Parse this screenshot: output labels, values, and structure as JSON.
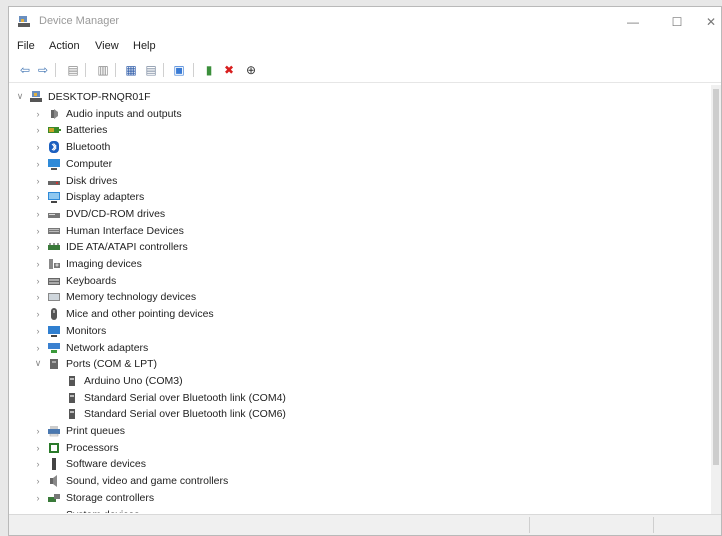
{
  "window": {
    "title": "Device Manager",
    "minimize": "—",
    "maximize": "☐",
    "close": "✕"
  },
  "menu": [
    "File",
    "Action",
    "View",
    "Help"
  ],
  "toolbar": [
    {
      "icon": "back-arrow-icon",
      "glyph": "⇦",
      "color": "#3a6fb0"
    },
    {
      "icon": "forward-arrow-icon",
      "glyph": "⇨",
      "color": "#3a6fb0"
    },
    {
      "icon": "properties-icon",
      "glyph": "▤",
      "color": "#8a8a8a"
    },
    {
      "icon": "help-icon",
      "glyph": "▥",
      "color": "#8a8a8a"
    },
    {
      "icon": "update-driver-icon",
      "glyph": "▦",
      "color": "#2c5aa8"
    },
    {
      "icon": "view-icon",
      "glyph": "▤",
      "color": "#7a8aa0"
    },
    {
      "icon": "scan-hardware-icon",
      "glyph": "▣",
      "color": "#3a7bd5"
    },
    {
      "icon": "enable-device-icon",
      "glyph": "▮",
      "color": "#3b8f3b"
    },
    {
      "icon": "uninstall-icon",
      "glyph": "✖",
      "color": "#d81e1e"
    },
    {
      "icon": "download-icon",
      "glyph": "⊕",
      "color": "#333333"
    }
  ],
  "tree": {
    "root": {
      "label": "DESKTOP-RNQR01F",
      "icon": "computer-root-icon",
      "expander": "∨"
    },
    "nodes": [
      {
        "label": "Audio inputs and outputs",
        "icon": "audio-icon",
        "expander": "›",
        "depth": 1
      },
      {
        "label": "Batteries",
        "icon": "battery-icon",
        "expander": "›",
        "depth": 1
      },
      {
        "label": "Bluetooth",
        "icon": "bluetooth-icon",
        "expander": "›",
        "depth": 1
      },
      {
        "label": "Computer",
        "icon": "computer-icon",
        "expander": "›",
        "depth": 1
      },
      {
        "label": "Disk drives",
        "icon": "disk-icon",
        "expander": "›",
        "depth": 1
      },
      {
        "label": "Display adapters",
        "icon": "display-adapter-icon",
        "expander": "›",
        "depth": 1
      },
      {
        "label": "DVD/CD-ROM drives",
        "icon": "dvd-icon",
        "expander": "›",
        "depth": 1
      },
      {
        "label": "Human Interface Devices",
        "icon": "hid-icon",
        "expander": "›",
        "depth": 1
      },
      {
        "label": "IDE ATA/ATAPI controllers",
        "icon": "ide-icon",
        "expander": "›",
        "depth": 1
      },
      {
        "label": "Imaging devices",
        "icon": "camera-icon",
        "expander": "›",
        "depth": 1
      },
      {
        "label": "Keyboards",
        "icon": "keyboard-icon",
        "expander": "›",
        "depth": 1
      },
      {
        "label": "Memory technology devices",
        "icon": "memory-icon",
        "expander": "›",
        "depth": 1
      },
      {
        "label": "Mice and other pointing devices",
        "icon": "mouse-icon",
        "expander": "›",
        "depth": 1
      },
      {
        "label": "Monitors",
        "icon": "monitor-icon",
        "expander": "›",
        "depth": 1
      },
      {
        "label": "Network adapters",
        "icon": "network-icon",
        "expander": "›",
        "depth": 1
      },
      {
        "label": "Ports (COM & LPT)",
        "icon": "port-icon",
        "expander": "∨",
        "depth": 1
      },
      {
        "label": "Arduino Uno (COM3)",
        "icon": "port-device-icon",
        "expander": "",
        "depth": 2
      },
      {
        "label": "Standard Serial over Bluetooth link (COM4)",
        "icon": "port-device-icon",
        "expander": "",
        "depth": 2
      },
      {
        "label": "Standard Serial over Bluetooth link (COM6)",
        "icon": "port-device-icon",
        "expander": "",
        "depth": 2
      },
      {
        "label": "Print queues",
        "icon": "printer-icon",
        "expander": "›",
        "depth": 1
      },
      {
        "label": "Processors",
        "icon": "processor-icon",
        "expander": "›",
        "depth": 1
      },
      {
        "label": "Software devices",
        "icon": "software-icon",
        "expander": "›",
        "depth": 1
      },
      {
        "label": "Sound, video and game controllers",
        "icon": "sound-icon",
        "expander": "›",
        "depth": 1
      },
      {
        "label": "Storage controllers",
        "icon": "storage-icon",
        "expander": "›",
        "depth": 1
      },
      {
        "label": "System devices",
        "icon": "system-icon",
        "expander": "›",
        "depth": 1
      }
    ]
  },
  "colors": {
    "accent": "#2f6fd0",
    "green": "#2a8a2a",
    "red": "#d81e1e"
  }
}
